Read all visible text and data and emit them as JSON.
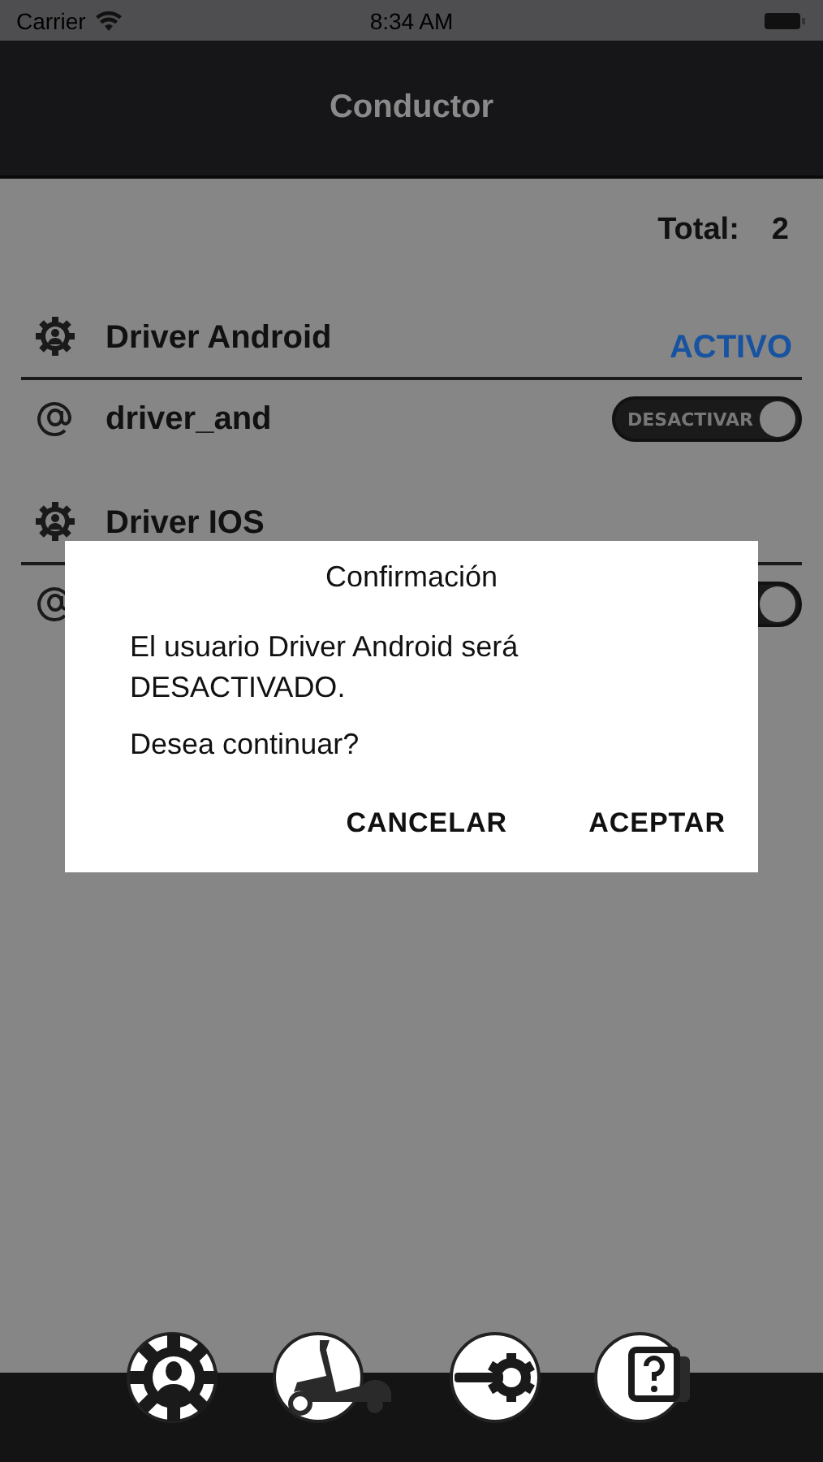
{
  "status_bar": {
    "carrier": "Carrier",
    "time": "8:34 AM"
  },
  "header": {
    "title": "Conductor"
  },
  "total": {
    "label": "Total:",
    "value": "2"
  },
  "users": [
    {
      "name": "Driver Android",
      "status": "ACTIVO",
      "username": "driver_and",
      "toggle": {
        "label": "DESACTIVAR",
        "on": true
      }
    },
    {
      "name": "Driver IOS",
      "toggle": {
        "on": true
      }
    }
  ],
  "dialog": {
    "title": "Confirmación",
    "lines": [
      "El usuario Driver Android será DESACTIVADO.",
      "Desea continuar?"
    ],
    "buttons": [
      "CANCELAR",
      "ACEPTAR"
    ]
  },
  "tab_bar": [
    {
      "kind": "drivers"
    },
    {
      "kind": "vehicles"
    },
    {
      "kind": "settings"
    },
    {
      "kind": "help"
    }
  ]
}
